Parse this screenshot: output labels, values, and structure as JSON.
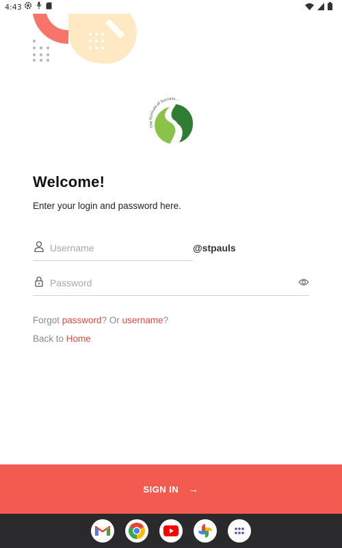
{
  "status_bar": {
    "time": "4:43",
    "left_icons": [
      "settings-icon",
      "mic-icon",
      "sd-card-icon"
    ],
    "right_icons": [
      "wifi-icon",
      "signal-icon",
      "battery-icon"
    ]
  },
  "logo": {
    "tagline": "The Formula of Success...",
    "letter": "S"
  },
  "welcome": {
    "title": "Welcome!",
    "subtitle": "Enter your login and password here."
  },
  "username": {
    "placeholder": "Username",
    "value": "",
    "suffix": "@stpauls"
  },
  "password": {
    "placeholder": "Password",
    "value": ""
  },
  "forgot": {
    "prefix": "Forgot ",
    "password_link": "password",
    "middle": "? Or ",
    "username_link": "username",
    "suffix": "?"
  },
  "back": {
    "prefix": "Back to ",
    "home_link": "Home"
  },
  "signin": {
    "label": "SIGN IN",
    "arrow": "→"
  },
  "dock": {
    "apps": [
      "gmail-icon",
      "chrome-icon",
      "youtube-icon",
      "photos-icon",
      "app-drawer-icon"
    ]
  },
  "colors": {
    "accent": "#f25b4f",
    "link": "#e34a3d",
    "logo_green_dark": "#2e7d32",
    "logo_green_light": "#8bc34a",
    "dock_bg": "#2a2a2c"
  }
}
